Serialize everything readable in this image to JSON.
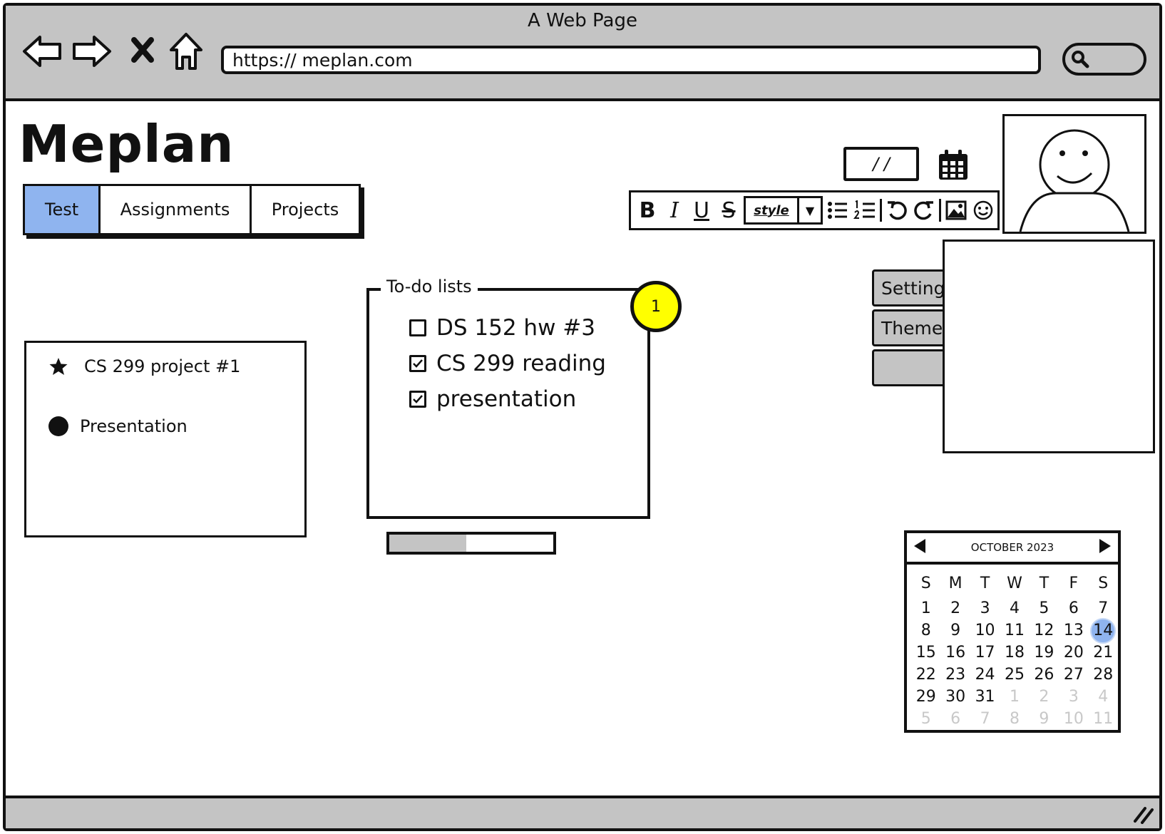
{
  "window": {
    "title": "A Web Page"
  },
  "address_bar": {
    "url": "https:// meplan.com"
  },
  "app": {
    "logo": "Meplan"
  },
  "tabs": [
    {
      "label": "Test",
      "active": true
    },
    {
      "label": "Assignments",
      "active": false
    },
    {
      "label": "Projects",
      "active": false
    }
  ],
  "date_field": {
    "value": "/ /"
  },
  "toolbar": {
    "bold": "B",
    "italic": "I",
    "underline": "U",
    "strike": "S",
    "style_label": "style",
    "icons": [
      "bold-icon",
      "italic-icon",
      "underline-icon",
      "strikethrough-icon",
      "bullet-list-icon",
      "numbered-list-icon",
      "undo-icon",
      "redo-icon",
      "image-icon",
      "emoji-icon"
    ]
  },
  "side_tabs": [
    {
      "label": "Setting"
    },
    {
      "label": "Theme"
    },
    {
      "label": ""
    }
  ],
  "tasks": [
    {
      "icon": "star-icon",
      "label": "CS 299 project #1"
    },
    {
      "icon": "bullet-icon",
      "label": "Presentation"
    }
  ],
  "todo": {
    "legend": "To-do lists",
    "badge": "1",
    "items": [
      {
        "label": "DS 152 hw #3",
        "checked": false
      },
      {
        "label": "CS 299 reading",
        "checked": true
      },
      {
        "label": "presentation",
        "checked": true
      }
    ]
  },
  "progress": {
    "value": 0.47
  },
  "calendar": {
    "month_label": "OCTOBER 2023",
    "weekdays": [
      "S",
      "M",
      "T",
      "W",
      "T",
      "F",
      "S"
    ],
    "selected_day": "14",
    "weeks": [
      [
        "1",
        "2",
        "3",
        "4",
        "5",
        "6",
        "7"
      ],
      [
        "8",
        "9",
        "10",
        "11",
        "12",
        "13",
        "14"
      ],
      [
        "15",
        "16",
        "17",
        "18",
        "19",
        "20",
        "21"
      ],
      [
        "22",
        "23",
        "24",
        "25",
        "26",
        "27",
        "28"
      ],
      [
        "29",
        "30",
        "31",
        "1",
        "2",
        "3",
        "4"
      ],
      [
        "5",
        "6",
        "7",
        "8",
        "9",
        "10",
        "11"
      ]
    ]
  },
  "colors": {
    "chrome_gray": "#c4c4c4",
    "active_tab": "#8fb4ef",
    "badge_yellow": "#ffff00"
  }
}
